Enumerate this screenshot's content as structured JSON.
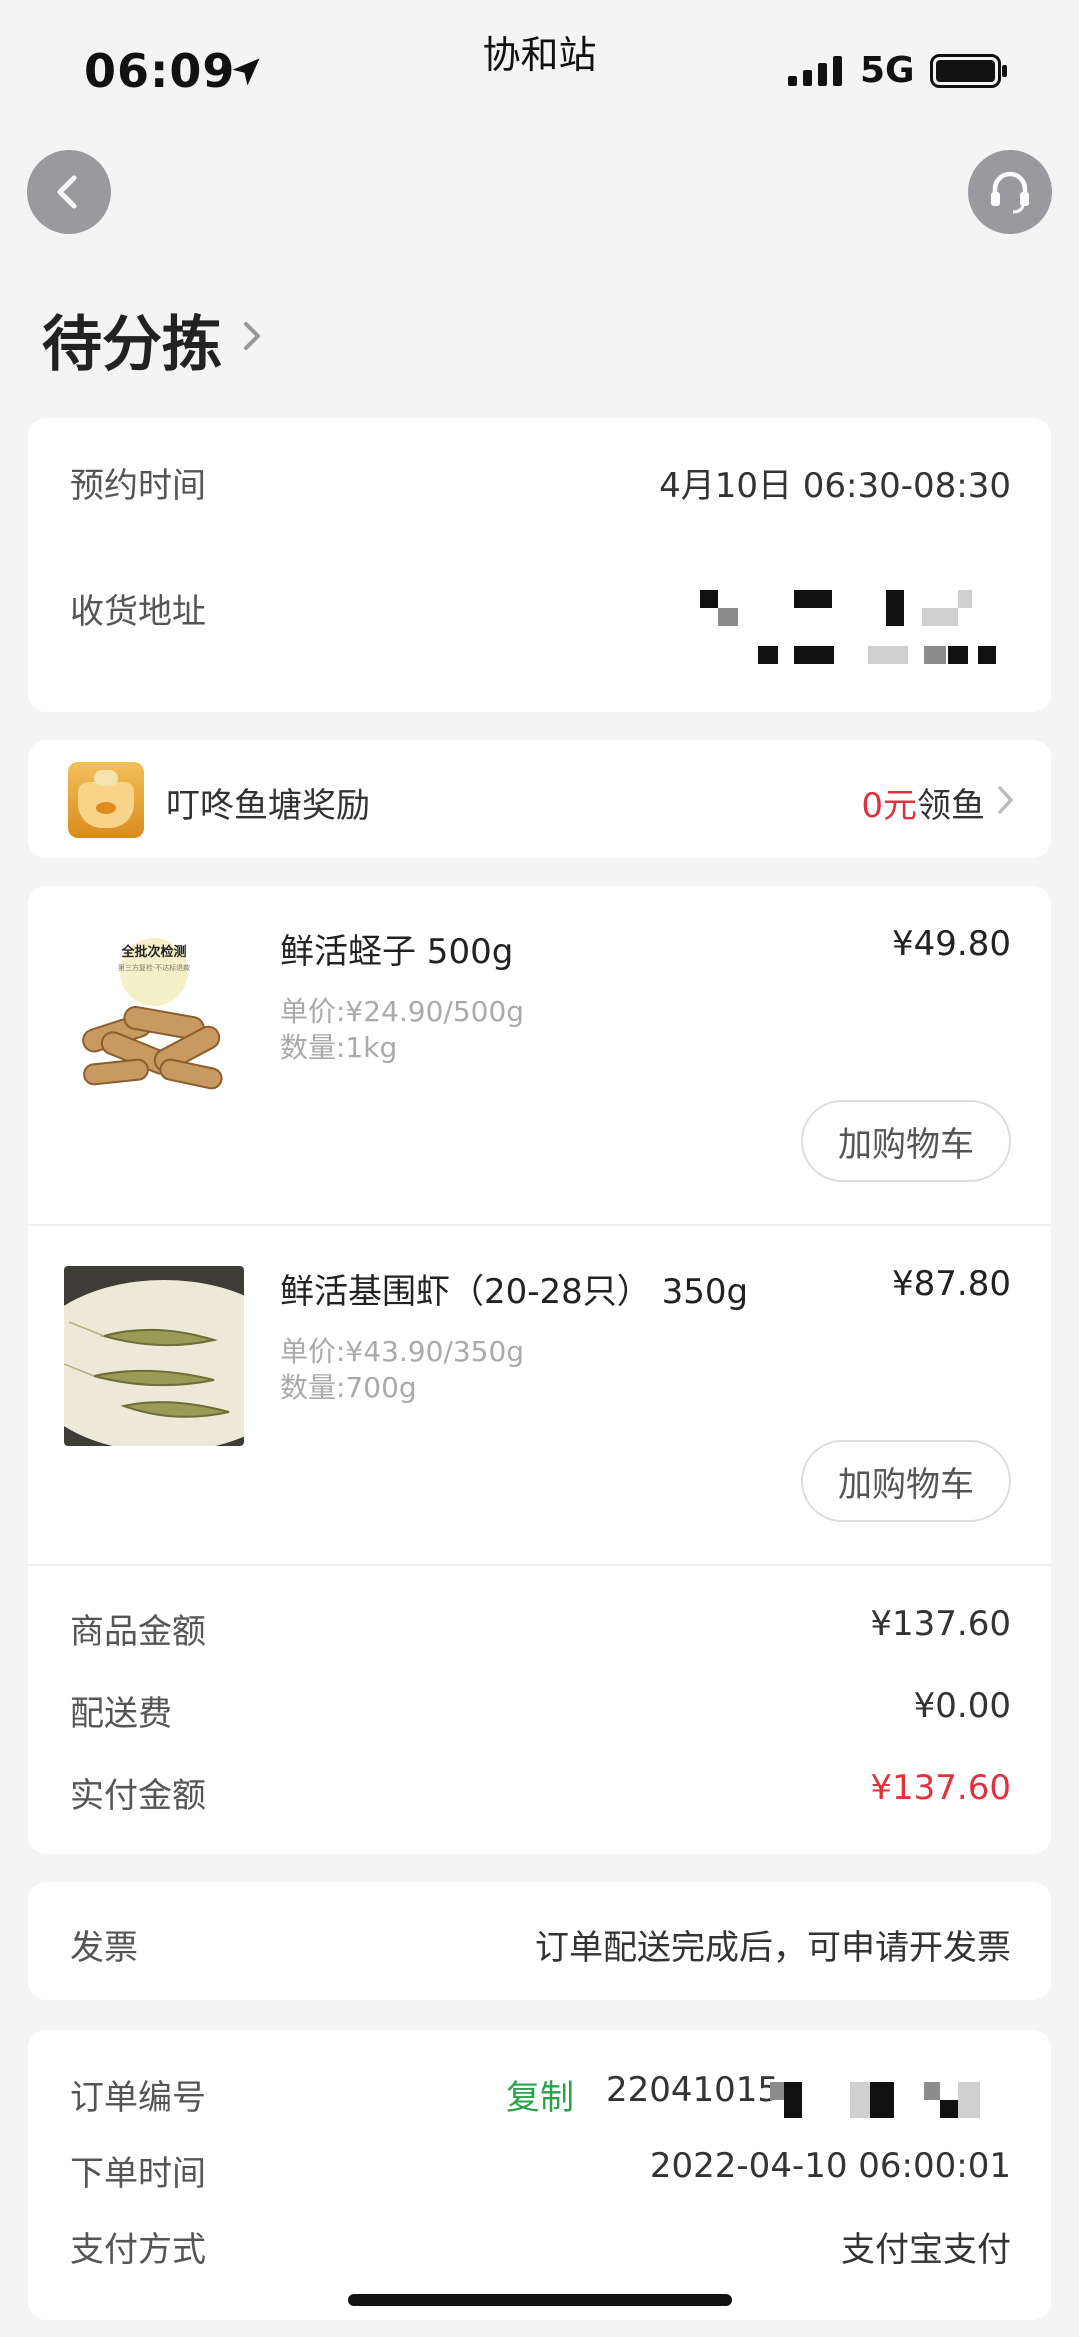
{
  "status_bar": {
    "time": "06:09",
    "carrier_title": "协和站",
    "network": "5G"
  },
  "page": {
    "title": "待分拣"
  },
  "delivery": {
    "time_label": "预约时间",
    "time_value": "4月10日 06:30-08:30",
    "address_label": "收货地址"
  },
  "reward": {
    "label": "叮咚鱼塘奖励",
    "amount": "0元",
    "action": "领鱼"
  },
  "products": [
    {
      "name": "鲜活蛏子 500g",
      "price": "¥49.80",
      "unit_price": "单价:¥24.90/500g",
      "quantity": "数量:1kg",
      "cart_label": "加购物车",
      "image_text_1": "全批次检测",
      "image_text_2": "第三方复检·不达标退款"
    },
    {
      "name": "鲜活基围虾（20-28只） 350g",
      "price": "¥87.80",
      "unit_price": "单价:¥43.90/350g",
      "quantity": "数量:700g",
      "cart_label": "加购物车"
    }
  ],
  "summary": {
    "goods_label": "商品金额",
    "goods_value": "¥137.60",
    "shipping_label": "配送费",
    "shipping_value": "¥0.00",
    "paid_label": "实付金额",
    "paid_value": "¥137.60"
  },
  "invoice": {
    "label": "发票",
    "value": "订单配送完成后，可申请开发票"
  },
  "order": {
    "number_label": "订单编号",
    "copy_label": "复制",
    "number_value": "22041015",
    "time_label": "下单时间",
    "time_value": "2022-04-10 06:00:01",
    "payment_label": "支付方式",
    "payment_value": "支付宝支付"
  },
  "colors": {
    "price_red": "#e0323c",
    "copy_green": "#2aa14a",
    "background": "#f4f4f5"
  },
  "icons": [
    "location-arrow-icon",
    "signal-icon",
    "battery-icon",
    "back-arrow-icon",
    "headset-icon",
    "chevron-right-icon",
    "fish-pond-reward-icon"
  ]
}
